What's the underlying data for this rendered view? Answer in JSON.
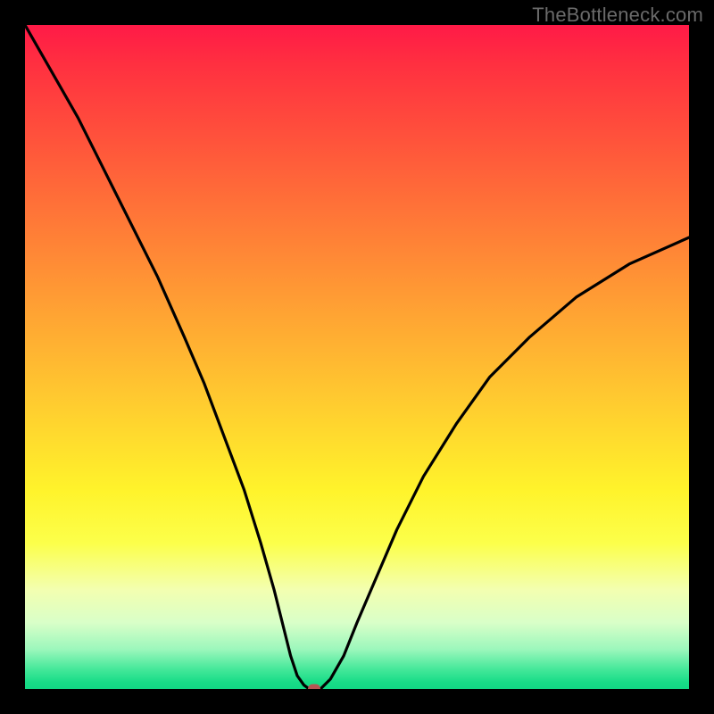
{
  "watermark": "TheBottleneck.com",
  "chart_data": {
    "type": "line",
    "title": "",
    "xlabel": "",
    "ylabel": "",
    "xlim": [
      0,
      100
    ],
    "ylim": [
      0,
      100
    ],
    "gradient_stops": [
      {
        "pct": 0,
        "color": "#ff1a47"
      },
      {
        "pct": 6,
        "color": "#ff3040"
      },
      {
        "pct": 18,
        "color": "#ff553b"
      },
      {
        "pct": 30,
        "color": "#ff7a37"
      },
      {
        "pct": 44,
        "color": "#ffa533"
      },
      {
        "pct": 58,
        "color": "#ffcf2f"
      },
      {
        "pct": 70,
        "color": "#fff32b"
      },
      {
        "pct": 78,
        "color": "#fcff4a"
      },
      {
        "pct": 85,
        "color": "#f3ffb0"
      },
      {
        "pct": 90,
        "color": "#d9ffc8"
      },
      {
        "pct": 94,
        "color": "#9cf7bc"
      },
      {
        "pct": 97,
        "color": "#45e89a"
      },
      {
        "pct": 99,
        "color": "#18dc87"
      },
      {
        "pct": 100,
        "color": "#12d884"
      }
    ],
    "series": [
      {
        "name": "bottleneck-curve",
        "x": [
          0,
          4,
          8,
          12,
          16,
          20,
          24,
          27,
          30,
          33,
          35.5,
          37.5,
          39,
          40,
          41,
          42,
          42.8,
          44.5,
          46,
          48,
          50,
          53,
          56,
          60,
          65,
          70,
          76,
          83,
          91,
          100
        ],
        "y": [
          100,
          93,
          86,
          78,
          70,
          62,
          53,
          46,
          38,
          30,
          22,
          15,
          9,
          5,
          2,
          0.6,
          0,
          0,
          1.5,
          5,
          10,
          17,
          24,
          32,
          40,
          47,
          53,
          59,
          64,
          68
        ]
      }
    ],
    "marker": {
      "x": 43.6,
      "y": 0,
      "color": "#b75454"
    },
    "grid": false,
    "legend": false
  }
}
